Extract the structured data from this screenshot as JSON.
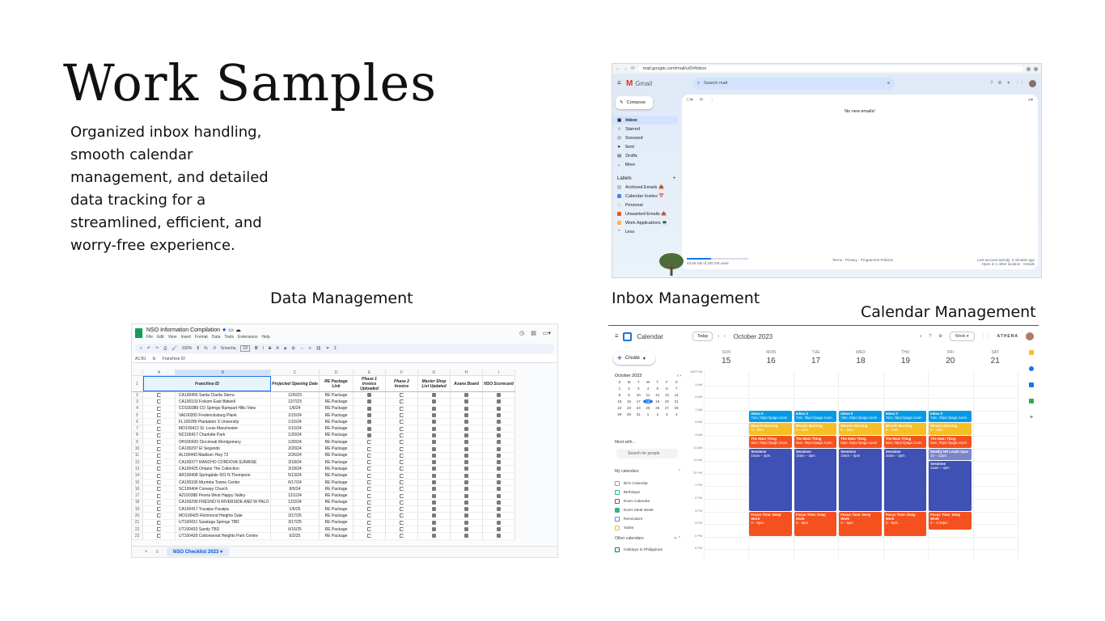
{
  "title": "Work Samples",
  "description": "Organized inbox handling, smooth calendar management, and detailed data tracking for a streamlined, efficient, and worry-free experience.",
  "captions": {
    "data": "Data Management",
    "inbox": "Inbox Management",
    "calendar": "Calendar Management"
  },
  "gmail": {
    "url": "mail.google.com/mail/u/0/#inbox",
    "app_name": "Gmail",
    "search_placeholder": "Search mail",
    "compose": "Compose",
    "nav": [
      "Inbox",
      "Starred",
      "Snoozed",
      "Sent",
      "Drafts",
      "More"
    ],
    "labels_title": "Labels",
    "labels": [
      {
        "name": "Archived Emails 📥",
        "color": "#bdbdbd"
      },
      {
        "name": "Calendar Invites 📅",
        "color": "#4285f4"
      },
      {
        "name": "Personal",
        "color": "#e0e0e0"
      },
      {
        "name": "Unwanted Emails 📤",
        "color": "#f4511e"
      },
      {
        "name": "Work Applications 💻",
        "color": "#f6bf26"
      },
      {
        "name": "Less",
        "color": ""
      }
    ],
    "empty_message": "No new emails!",
    "storage": "43.66 GB of 100 GB used",
    "footer_links": "Terms · Privacy · Programme Policies",
    "activity": "Last account activity: 0 minutes ago",
    "activity_sub": "Open in 1 other location · Details"
  },
  "sheets": {
    "doc_title": "NSO Information Compilation",
    "menu": [
      "File",
      "Edit",
      "View",
      "Insert",
      "Format",
      "Data",
      "Tools",
      "Extensions",
      "Help"
    ],
    "toolbar": {
      "zoom": "100%",
      "font": "Sriracha",
      "size": "10"
    },
    "cell_ref": "A1:B1",
    "formula": "Franchise ID",
    "col_letters": [
      "A",
      "B",
      "C",
      "D",
      "E",
      "F",
      "G",
      "H",
      "I"
    ],
    "fields": [
      "Franchise ID",
      "Projected Opening Date",
      "RE Package Link",
      "Phase 1 Invoice Uploaded",
      "Phase 2 Invoice",
      "Master Shop List Updated",
      "Asana Board",
      "NSO Scorecard"
    ],
    "rows": [
      {
        "n": "2",
        "id": "CA100455 Santa Clarita Sierra",
        "date": "12/6/23",
        "pkg": "RE Package",
        "c": [
          1,
          0,
          1,
          1,
          1
        ]
      },
      {
        "n": "3",
        "id": "CA100103 Folsom East Bidwell",
        "date": "12/7/23",
        "pkg": "RE Package",
        "c": [
          1,
          0,
          1,
          1,
          1
        ]
      },
      {
        "n": "4",
        "id": "CO100389 CO Springs Rampart Hills View",
        "date": "1/6/24",
        "pkg": "RE Package",
        "c": [
          1,
          0,
          1,
          1,
          1
        ]
      },
      {
        "n": "5",
        "id": "VA100355 Fredericksburg Plank",
        "date": "1/15/24",
        "pkg": "RE Package",
        "c": [
          1,
          0,
          1,
          1,
          1
        ]
      },
      {
        "n": "6",
        "id": "FL100289 Plantation S University",
        "date": "1/15/24",
        "pkg": "RE Package",
        "c": [
          1,
          0,
          1,
          1,
          1
        ]
      },
      {
        "n": "7",
        "id": "MO100412 St. Louis Manchester",
        "date": "1/15/24",
        "pkg": "RE Package",
        "c": [
          1,
          0,
          1,
          1,
          1
        ]
      },
      {
        "n": "8",
        "id": "NC100417 Charlotte Park",
        "date": "1/20/24",
        "pkg": "RE Package",
        "c": [
          1,
          0,
          1,
          1,
          1
        ]
      },
      {
        "n": "9",
        "id": "OH100420 Cincinnati Montgomery",
        "date": "1/20/24",
        "pkg": "RE Package",
        "c": [
          0,
          0,
          1,
          1,
          1
        ]
      },
      {
        "n": "10",
        "id": "CA100297 El Segundo",
        "date": "2/20/24",
        "pkg": "RE Package",
        "c": [
          0,
          0,
          1,
          1,
          1
        ]
      },
      {
        "n": "11",
        "id": "AL100443 Madison Hwy 72",
        "date": "2/26/24",
        "pkg": "RE Package",
        "c": [
          0,
          0,
          1,
          1,
          1
        ]
      },
      {
        "n": "12",
        "id": "CA100377 RANCHO CORDOVA SUNRISE",
        "date": "3/18/24",
        "pkg": "RE Package",
        "c": [
          0,
          0,
          1,
          1,
          1
        ]
      },
      {
        "n": "13",
        "id": "CA100425 Ontario The Collection",
        "date": "3/18/24",
        "pkg": "RE Package",
        "c": [
          0,
          0,
          1,
          1,
          1
        ]
      },
      {
        "n": "14",
        "id": "AR100408 Springdale 601 N Thompson",
        "date": "5/13/24",
        "pkg": "RE Package",
        "c": [
          0,
          0,
          1,
          1,
          1
        ]
      },
      {
        "n": "15",
        "id": "CA100336 Murrieta Towne Center",
        "date": "6/17/24",
        "pkg": "RE Package",
        "c": [
          0,
          0,
          1,
          1,
          1
        ]
      },
      {
        "n": "16",
        "id": "SC100404 Conway Church",
        "date": "8/5/24",
        "pkg": "RE Package",
        "c": [
          0,
          0,
          1,
          1,
          1
        ]
      },
      {
        "n": "17",
        "id": "AZ100388 Peoria West Happy Valley",
        "date": "12/1/24",
        "pkg": "RE Package",
        "c": [
          0,
          0,
          1,
          1,
          1
        ]
      },
      {
        "n": "18",
        "id": "CA100299 FRESNO N RIVERSIDE AND W PALO",
        "date": "12/2/24",
        "pkg": "RE Package",
        "c": [
          0,
          0,
          1,
          1,
          1
        ]
      },
      {
        "n": "19",
        "id": "CA100417 Yucaipa Yucaipa",
        "date": "1/6/25",
        "pkg": "RE Package",
        "c": [
          0,
          0,
          1,
          1,
          1
        ]
      },
      {
        "n": "20",
        "id": "MO100425 Richmond Heights Dale",
        "date": "3/17/25",
        "pkg": "RE Package",
        "c": [
          0,
          0,
          1,
          1,
          1
        ]
      },
      {
        "n": "21",
        "id": "UT100431 Saratoga Springs TBD",
        "date": "3/17/25",
        "pkg": "RE Package",
        "c": [
          0,
          0,
          1,
          1,
          1
        ]
      },
      {
        "n": "22",
        "id": "UT100433 Sandy TBD",
        "date": "6/16/25",
        "pkg": "RE Package",
        "c": [
          0,
          0,
          1,
          1,
          1
        ]
      },
      {
        "n": "23",
        "id": "UT100430 Cottonwood Heights Park Centre",
        "date": "6/2/25",
        "pkg": "RE Package",
        "c": [
          0,
          0,
          1,
          1,
          1
        ]
      }
    ],
    "sheet_tab": "NSO Checklist 2023"
  },
  "calendar": {
    "app_name": "Calendar",
    "today": "Today",
    "month": "October 2023",
    "view": "Week",
    "account": "ATHENA",
    "create": "Create",
    "mini_month": "October 2023",
    "mini_days": [
      "S",
      "M",
      "T",
      "W",
      "T",
      "F",
      "S",
      "1",
      "2",
      "3",
      "4",
      "5",
      "6",
      "7",
      "8",
      "9",
      "10",
      "11",
      "12",
      "13",
      "14",
      "15",
      "16",
      "17",
      "18",
      "19",
      "20",
      "21",
      "22",
      "23",
      "24",
      "25",
      "26",
      "27",
      "28",
      "29",
      "30",
      "31",
      "1",
      "2",
      "3",
      "4"
    ],
    "meet_with": "Meet with...",
    "search_people": "Search for people",
    "my_calendars": "My calendars",
    "calendars": [
      {
        "name": "Bri's Calendar",
        "color": "#e67c73",
        "checked": false
      },
      {
        "name": "Birthdays",
        "color": "#33b679",
        "checked": false
      },
      {
        "name": "Eva's Calendar",
        "color": "#616161",
        "checked": false
      },
      {
        "name": "Eva's Ideal Week",
        "color": "#33b679",
        "checked": true
      },
      {
        "name": "Reminders",
        "color": "#7986cb",
        "checked": false
      },
      {
        "name": "Tasks",
        "color": "#f6bf26",
        "checked": false
      }
    ],
    "other_calendars": "Other calendars",
    "other": [
      {
        "name": "Holidays in Philippines",
        "color": "#0b8043"
      }
    ],
    "timezone": "GMT+08",
    "days": [
      {
        "dow": "SUN",
        "num": "15"
      },
      {
        "dow": "MON",
        "num": "16"
      },
      {
        "dow": "TUE",
        "num": "17"
      },
      {
        "dow": "WED",
        "num": "18"
      },
      {
        "dow": "THU",
        "num": "19"
      },
      {
        "dow": "FRI",
        "num": "20"
      },
      {
        "dow": "SAT",
        "num": "21"
      }
    ],
    "hours": [
      "5 AM",
      "6 AM",
      "7 AM",
      "8 AM",
      "9 AM",
      "10 AM",
      "11 AM",
      "12 PM",
      "1 PM",
      "2 PM",
      "3 PM",
      "4 PM",
      "5 PM",
      "6 PM"
    ],
    "colors": {
      "blue_light": "#039be5",
      "yellow": "#f6bf26",
      "orange": "#f4511e",
      "indigo": "#3f51b5",
      "lavender": "#7986cb"
    },
    "events": {
      "inbox0": {
        "title": "Inbox 0",
        "time": "7am, https://page.zoom"
      },
      "miracle": {
        "title": "Miracle Morning",
        "time": "8 – 9am"
      },
      "main": {
        "title": "The Main Thing",
        "time": "9am, https://page.zoom"
      },
      "sessions": {
        "title": "Sessions",
        "time": "10am – 3pm"
      },
      "focus": {
        "title": "Focus Time: Deep Work",
        "time": "3 – 5pm"
      },
      "weekly": {
        "title": "Weekly HR Leads Sync",
        "time": "10 – 11am"
      },
      "fri_sessions": {
        "title": "Sessions",
        "time": "11am – 3pm"
      },
      "fri_focus": {
        "title": "Focus Time: Deep Work",
        "time": "3 – 4:30pm"
      }
    }
  }
}
